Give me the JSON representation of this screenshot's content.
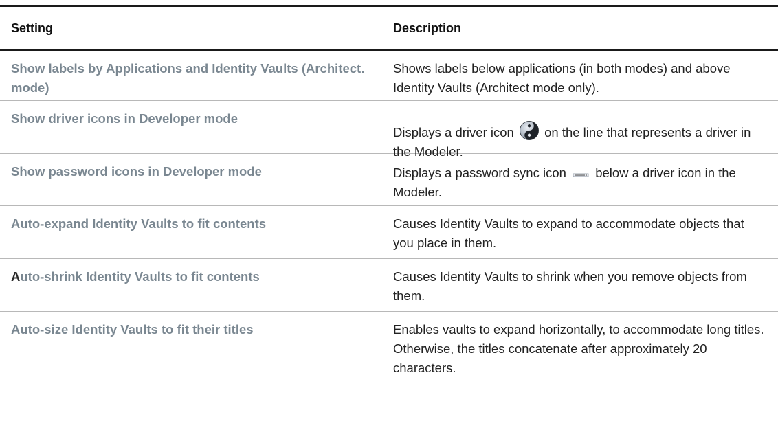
{
  "table": {
    "header": {
      "setting": "Setting",
      "description": "Description"
    },
    "rows": [
      {
        "setting": "Show labels by Applications and Identity Vaults (Architect. mode)",
        "description": "Shows labels below applications (in both modes) and above Identity Vaults (Architect mode only)."
      },
      {
        "setting": "Show driver icons in Developer mode",
        "description_before": "Displays a driver icon",
        "description_after": "on the line that represents a driver in the Modeler.",
        "icon": "yin-yang-driver-icon"
      },
      {
        "setting": "Show password icons in Developer mode",
        "description_before": "Displays a password sync icon",
        "description_after": "below a driver icon in the Modeler.",
        "icon": "password-sync-icon"
      },
      {
        "setting": "Auto-expand Identity Vaults to fit contents",
        "description": "Causes Identity Vaults to expand to accommodate objects that you place in them."
      },
      {
        "setting_first": "A",
        "setting_rest": "uto-shrink Identity Vaults to fit contents",
        "description": "Causes Identity Vaults to shrink when you remove objects from them."
      },
      {
        "setting": "Auto-size Identity Vaults to fit their titles",
        "description": "Enables vaults to expand horizontally, to accommodate long titles. Otherwise, the titles concatenate after approximately 20 characters."
      }
    ]
  },
  "colors": {
    "setting_text": "#7a8791",
    "rule": "#1a1a1a",
    "row_divider": "#b8b8b8"
  }
}
